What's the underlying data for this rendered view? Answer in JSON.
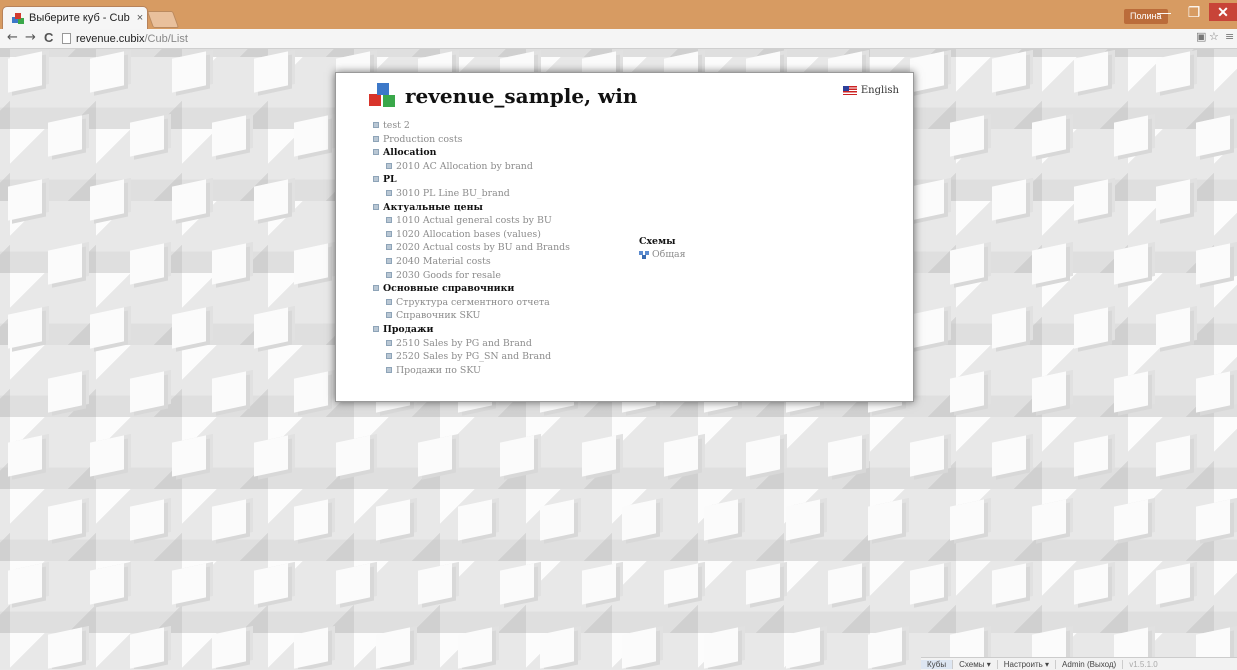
{
  "browser": {
    "tab_title": "Выберите куб - Cub",
    "tab_close": "×",
    "user_badge": "Полина",
    "url_host": "revenue.cubix",
    "url_path": "/Cub/List",
    "back": "←",
    "forward": "→",
    "reload": "C"
  },
  "panel": {
    "title": "revenue_sample, win",
    "language": "English",
    "tree": [
      {
        "label": "test 2",
        "type": "leaf",
        "level": 1
      },
      {
        "label": "Production costs",
        "type": "leaf",
        "level": 1
      },
      {
        "label": "Allocation",
        "type": "group",
        "level": 1
      },
      {
        "label": "2010 AC Allocation by brand",
        "type": "leaf",
        "level": 2
      },
      {
        "label": "PL",
        "type": "group",
        "level": 1
      },
      {
        "label": "3010 PL Line BU_brand",
        "type": "leaf",
        "level": 2
      },
      {
        "label": "Актуальные цены",
        "type": "group",
        "level": 1
      },
      {
        "label": "1010 Actual general costs by BU",
        "type": "leaf",
        "level": 2
      },
      {
        "label": "1020 Allocation bases (values)",
        "type": "leaf",
        "level": 2
      },
      {
        "label": "2020 Actual costs by BU and Brands",
        "type": "leaf",
        "level": 2
      },
      {
        "label": "2040 Material costs",
        "type": "leaf",
        "level": 2
      },
      {
        "label": "2030 Goods for resale",
        "type": "leaf",
        "level": 2
      },
      {
        "label": "Основные справочники",
        "type": "group",
        "level": 1
      },
      {
        "label": "Структура сегментного отчета",
        "type": "leaf",
        "level": 2
      },
      {
        "label": "Справочник SKU",
        "type": "leaf",
        "level": 2
      },
      {
        "label": "Продажи",
        "type": "group",
        "level": 1
      },
      {
        "label": "2510 Sales by PG and Brand",
        "type": "leaf",
        "level": 2
      },
      {
        "label": "2520 Sales by PG_SN and Brand",
        "type": "leaf",
        "level": 2
      },
      {
        "label": "Продажи по SKU",
        "type": "leaf",
        "level": 2
      }
    ],
    "schemes": {
      "header": "Схемы",
      "items": [
        "Общая"
      ]
    }
  },
  "bottombar": {
    "items": [
      "Кубы",
      "Схемы ▾",
      "Настроить ▾",
      "Admin (Выход)"
    ],
    "version": "v1.5.1.0"
  },
  "colors": {
    "titlebar": "#d79b62",
    "close_button": "#c84438",
    "leaf_text": "#8c8c8c",
    "group_text": "#111111"
  }
}
